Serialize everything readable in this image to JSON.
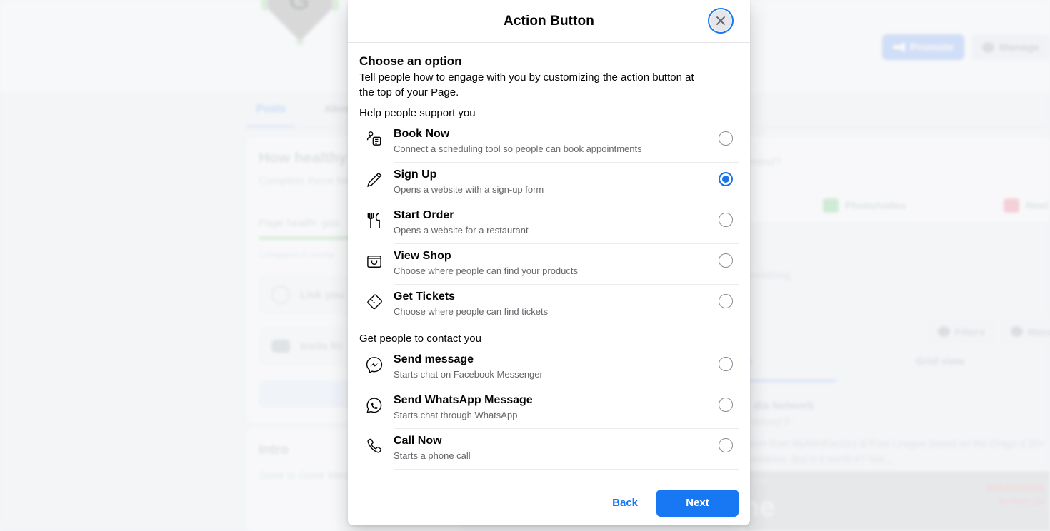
{
  "modal": {
    "title": "Action Button",
    "close_icon": "close-icon",
    "section": {
      "heading": "Choose an option",
      "description": "Tell people how to engage with you by customizing the action button at the top of your Page."
    },
    "groups": [
      {
        "label": "Help people support you",
        "options": [
          {
            "icon": "book-appointment-icon",
            "title": "Book Now",
            "subtitle": "Connect a scheduling tool so people can book appointments",
            "selected": false
          },
          {
            "icon": "pencil-icon",
            "title": "Sign Up",
            "subtitle": "Opens a website with a sign-up form",
            "selected": true
          },
          {
            "icon": "cutlery-icon",
            "title": "Start Order",
            "subtitle": "Opens a website for a restaurant",
            "selected": false
          },
          {
            "icon": "shopping-bag-icon",
            "title": "View Shop",
            "subtitle": "Choose where people can find your products",
            "selected": false
          },
          {
            "icon": "ticket-icon",
            "title": "Get Tickets",
            "subtitle": "Choose where people can find tickets",
            "selected": false
          }
        ]
      },
      {
        "label": "Get people to contact you",
        "options": [
          {
            "icon": "messenger-icon",
            "title": "Send message",
            "subtitle": "Starts chat on Facebook Messenger",
            "selected": false
          },
          {
            "icon": "whatsapp-icon",
            "title": "Send WhatsApp Message",
            "subtitle": "Starts chat through WhatsApp",
            "selected": false
          },
          {
            "icon": "phone-icon",
            "title": "Call Now",
            "subtitle": "Starts a phone call",
            "selected": false
          }
        ]
      }
    ],
    "footer": {
      "back_label": "Back",
      "next_label": "Next"
    }
  },
  "colors": {
    "accent_blue": "#1877f2",
    "selected_radio": "#1b74e4",
    "text_primary": "#050505",
    "text_secondary": "#65676b",
    "divider": "#e4e6eb"
  },
  "background": {
    "buttons": {
      "promote": "Promote",
      "manage": "Manage"
    },
    "tabs": [
      "Posts",
      "About"
    ],
    "left_card": {
      "heading": "How healthy",
      "paragraph": "Complete these\nMedia Network",
      "health_label": "Page health: goo",
      "compare_label": "Compared to similar",
      "rows": [
        "Link you",
        "Invite fri"
      ]
    },
    "intro": {
      "title": "Intro",
      "text": "Geek to Geek Med"
    },
    "composer": {
      "placeholder": "r mind?",
      "photo_video": "Photo/video",
      "reel": "Reel",
      "pin_hint": "you pin something."
    },
    "feed": {
      "filters": "Filters",
      "manage": "Mana",
      "list_view": "view",
      "grid_view": "Grid view",
      "post_author": "dia Network",
      "post_meta": "· January 2 ·",
      "post_body": "iption from MyMiniFactory & Free League based on the Drago\nd 20+ printables. But is it worth it? Yes...",
      "photo_caption": "ne",
      "photo_small": "ents",
      "photo_brand": "DRAGONS",
      "photo_brand_sub": "By FREE LEA"
    }
  }
}
